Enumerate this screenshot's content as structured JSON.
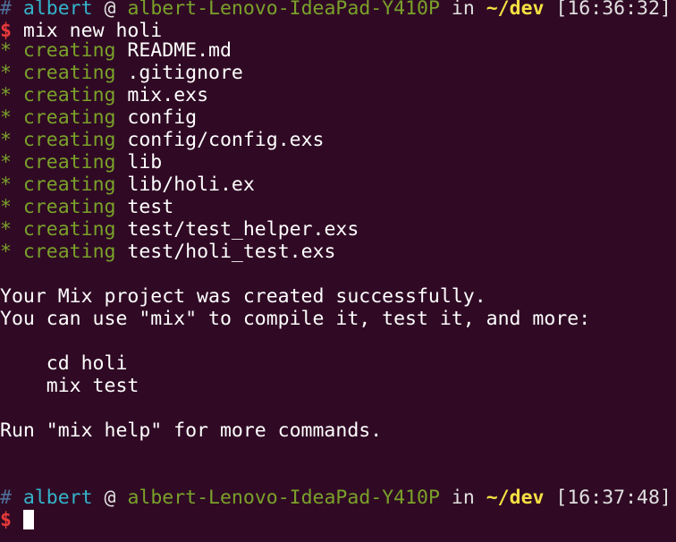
{
  "prompt1": {
    "hash": "#",
    "user": "albert",
    "at": "@",
    "host": "albert-Lenovo-IdeaPad-Y410P",
    "in": "in",
    "dir": "~/dev",
    "time": "[16:36:32]"
  },
  "command": {
    "dollar": "$",
    "text": "mix new holi"
  },
  "created": {
    "star": "*",
    "verb": "creating",
    "files": [
      "README.md",
      ".gitignore",
      "mix.exs",
      "config",
      "config/config.exs",
      "lib",
      "lib/holi.ex",
      "test",
      "test/test_helper.exs",
      "test/holi_test.exs"
    ]
  },
  "output": {
    "line1": "Your Mix project was created successfully.",
    "line2": "You can use \"mix\" to compile it, test it, and more:",
    "cmd1": "    cd holi",
    "cmd2": "    mix test",
    "line3": "Run \"mix help\" for more commands."
  },
  "prompt2": {
    "hash": "#",
    "user": "albert",
    "at": "@",
    "host": "albert-Lenovo-IdeaPad-Y410P",
    "in": "in",
    "dir": "~/dev",
    "time": "[16:37:48]"
  },
  "input": {
    "dollar": "$"
  }
}
